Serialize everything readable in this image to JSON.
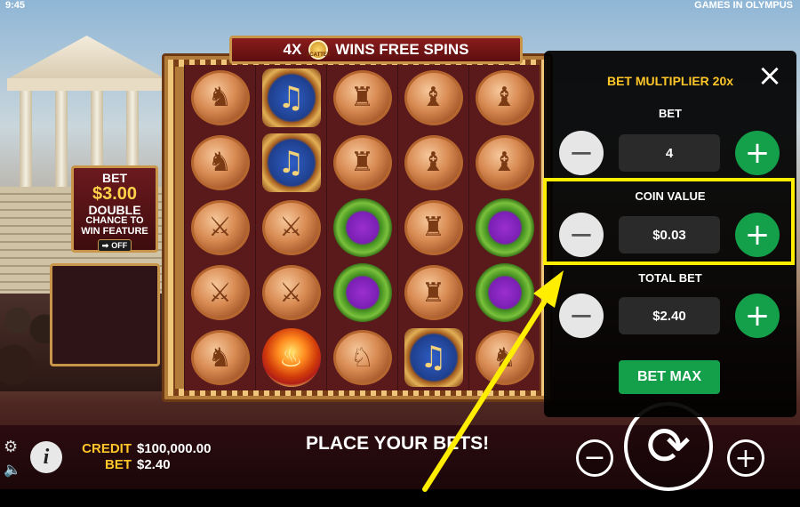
{
  "status": {
    "time": "9:45",
    "game_name": "GAMES IN OLYMPUS"
  },
  "banner": {
    "prefix": "4X",
    "scatter_label": "SCATTER",
    "suffix": "WINS FREE SPINS"
  },
  "double_chance": {
    "line1": "BET",
    "line2": "$3.00",
    "line3": "DOUBLE",
    "line4": "CHANCE TO",
    "line5": "WIN FEATURE",
    "toggle_arrow": "➡",
    "toggle_state": "OFF"
  },
  "reels": [
    [
      "discus-thrower-coin",
      "discus-thrower-coin",
      "wrestlers-coin",
      "wrestlers-coin",
      "discus-thrower-coin"
    ],
    [
      "lyre",
      "lyre",
      "wrestlers-coin",
      "wrestlers-coin",
      "torch"
    ],
    [
      "boxer-coin",
      "boxer-coin",
      "laurel-wreath",
      "laurel-wreath",
      "chariot-coin"
    ],
    [
      "javelin-coin",
      "javelin-coin",
      "boxer-coin",
      "boxer-coin",
      "lyre"
    ],
    [
      "javelin-coin",
      "javelin-coin",
      "laurel-wreath",
      "laurel-wreath",
      "discus-thrower-coin"
    ]
  ],
  "bottom": {
    "credit_label": "CREDIT",
    "credit_value": "$100,000.00",
    "bet_label": "BET",
    "bet_value": "$2.40",
    "message": "PLACE YOUR BETS!",
    "info_label": "i"
  },
  "bet_panel": {
    "multiplier": "BET MULTIPLIER 20x",
    "bet_label": "BET",
    "bet_value": "4",
    "coin_label": "COIN VALUE",
    "coin_value": "$0.03",
    "total_label": "TOTAL BET",
    "total_value": "$2.40",
    "bet_max": "BET MAX",
    "close_icon": "×",
    "minus_icon": "−",
    "plus_icon": "+"
  },
  "icons": {
    "spin": "⟳",
    "gear": "⚙",
    "speaker": "🔈"
  },
  "colors": {
    "highlight": "#ffee00",
    "accent_gold": "#ffc629",
    "green": "#14a04a"
  }
}
